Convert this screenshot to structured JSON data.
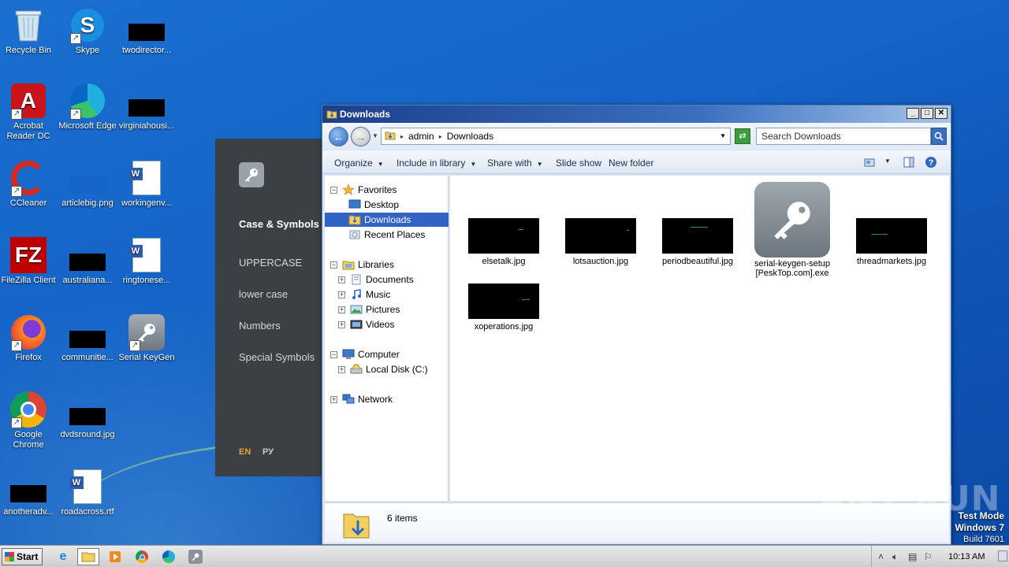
{
  "desktop": {
    "icons": [
      {
        "label": "Recycle Bin"
      },
      {
        "label": "Skype"
      },
      {
        "label": "twodirector..."
      },
      {
        "label": "Acrobat Reader DC"
      },
      {
        "label": "Microsoft Edge"
      },
      {
        "label": "virginiahousi..."
      },
      {
        "label": "CCleaner"
      },
      {
        "label": "articlebig.png"
      },
      {
        "label": "workingenv..."
      },
      {
        "label": "FileZilla Client"
      },
      {
        "label": "australiana..."
      },
      {
        "label": "ringtonese..."
      },
      {
        "label": "Firefox"
      },
      {
        "label": "communitie..."
      },
      {
        "label": "Serial KeyGen"
      },
      {
        "label": "Google Chrome"
      },
      {
        "label": "dvdsround.jpg"
      },
      {
        "label": "anotheradv..."
      },
      {
        "label": "roadacross.rtf"
      }
    ]
  },
  "keygen": {
    "title": "Case & Symbols",
    "options": [
      "UPPERCASE",
      "lower case",
      "Numbers",
      "Special Symbols"
    ],
    "lang_en": "EN",
    "lang_ru": "РУ"
  },
  "explorer": {
    "title": "Downloads",
    "breadcrumb": [
      "admin",
      "Downloads"
    ],
    "search_placeholder": "Search Downloads",
    "toolbar": {
      "organize": "Organize",
      "include": "Include in library",
      "share": "Share with",
      "slideshow": "Slide show",
      "newfolder": "New folder"
    },
    "nav": {
      "favorites": "Favorites",
      "desktop": "Desktop",
      "downloads": "Downloads",
      "recent": "Recent Places",
      "libraries": "Libraries",
      "documents": "Documents",
      "music": "Music",
      "pictures": "Pictures",
      "videos": "Videos",
      "computer": "Computer",
      "localdisk": "Local Disk (C:)",
      "network": "Network"
    },
    "files": [
      {
        "name": "elsetalk.jpg"
      },
      {
        "name": "lotsauction.jpg"
      },
      {
        "name": "periodbeautiful.jpg"
      },
      {
        "name": "serial-keygen-setup [PeskTop.com].exe"
      },
      {
        "name": "threadmarkets.jpg"
      },
      {
        "name": "xoperations.jpg"
      }
    ],
    "item_count": "6 items"
  },
  "taskbar": {
    "start": "Start",
    "clock": "10:13 AM"
  },
  "overlay": {
    "watermark": "ANY RUN",
    "test_mode": "Test Mode",
    "os": "Windows 7",
    "build": "Build 7601"
  }
}
